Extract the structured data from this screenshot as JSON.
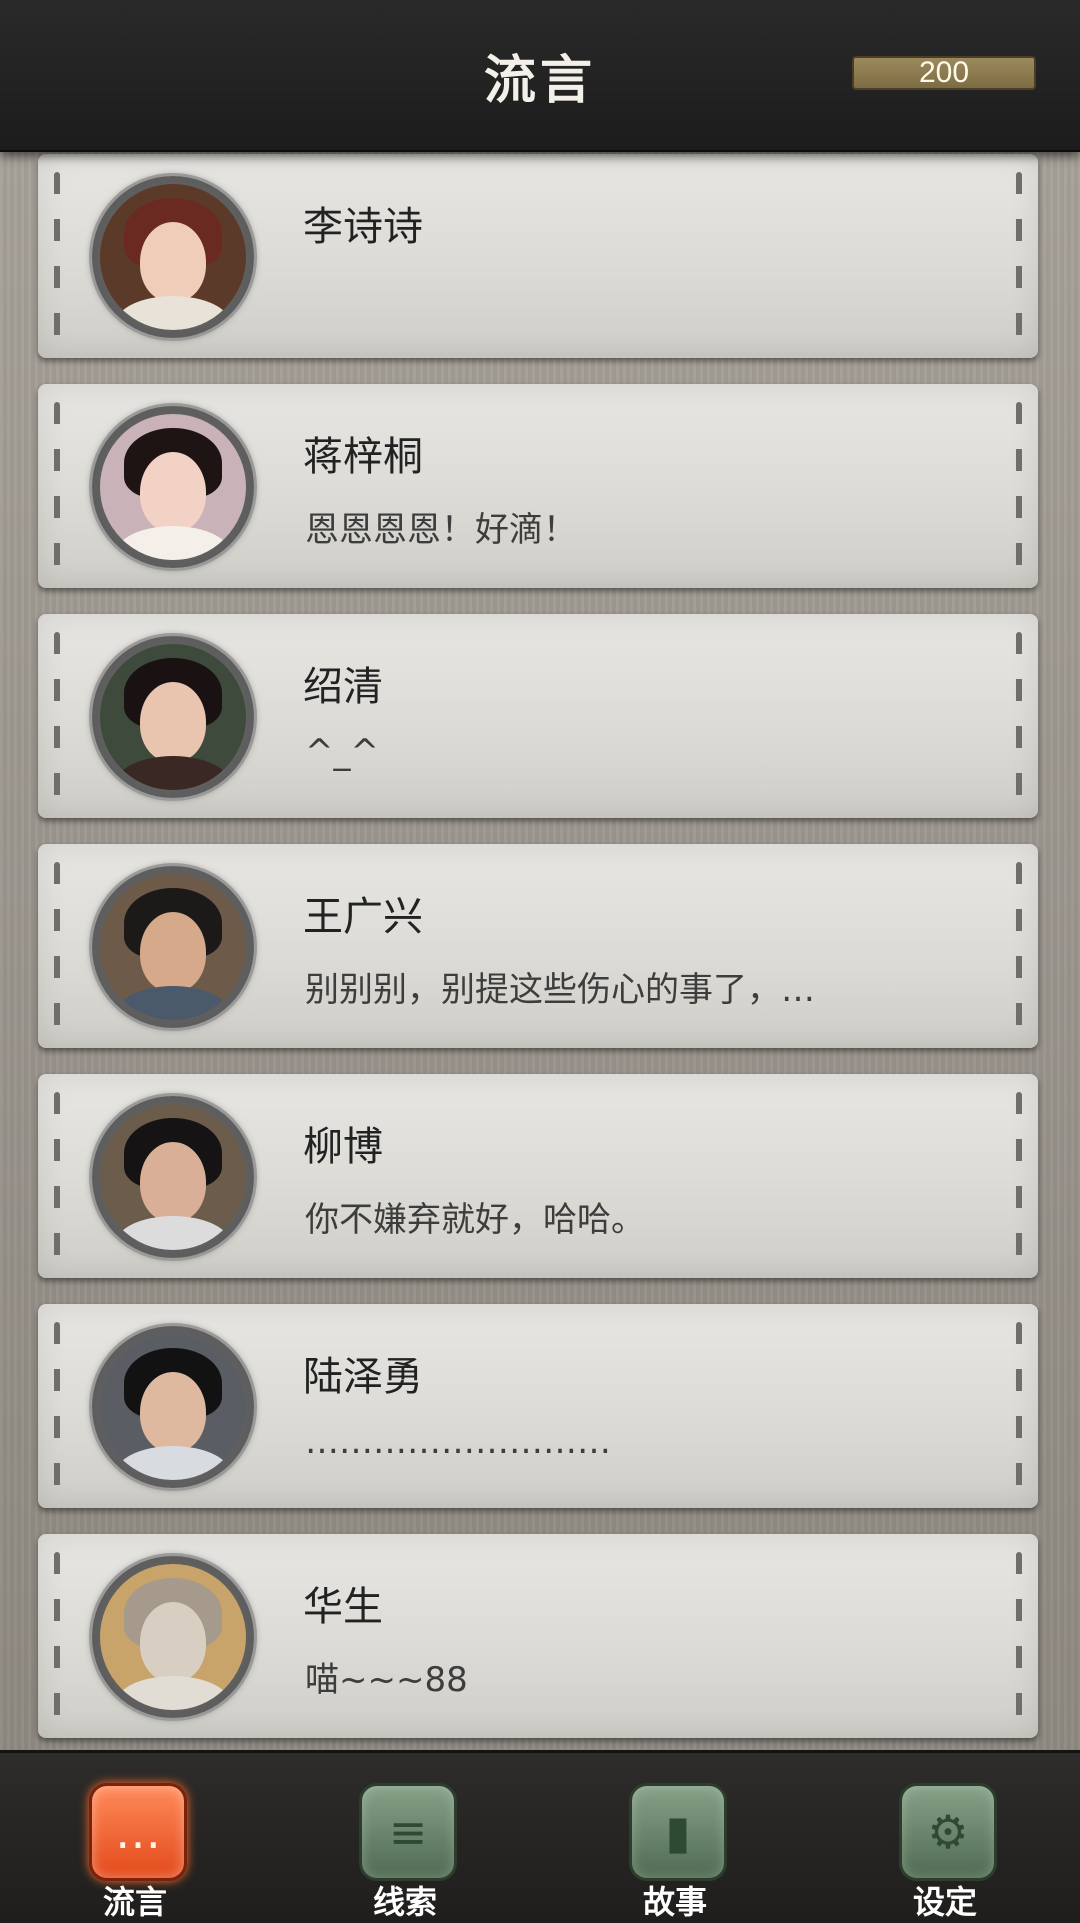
{
  "header": {
    "title": "流言",
    "coins": "200"
  },
  "contacts": [
    {
      "name": "李诗诗",
      "message": ""
    },
    {
      "name": "蒋梓桐",
      "message": "恩恩恩恩！好滴！"
    },
    {
      "name": "绍清",
      "message": "^_^"
    },
    {
      "name": "王广兴",
      "message": "别别别，别提这些伤心的事了，…"
    },
    {
      "name": "柳博",
      "message": "你不嫌弃就好，哈哈。"
    },
    {
      "name": "陆泽勇",
      "message": "………………………"
    },
    {
      "name": "华生",
      "message": "喵~~~88"
    }
  ],
  "tabs": [
    {
      "label": "流言",
      "icon": "chat-bubble-icon",
      "active": true
    },
    {
      "label": "线索",
      "icon": "paper-icon",
      "active": false
    },
    {
      "label": "故事",
      "icon": "book-icon",
      "active": false
    },
    {
      "label": "设定",
      "icon": "gear-icon",
      "active": false
    }
  ]
}
